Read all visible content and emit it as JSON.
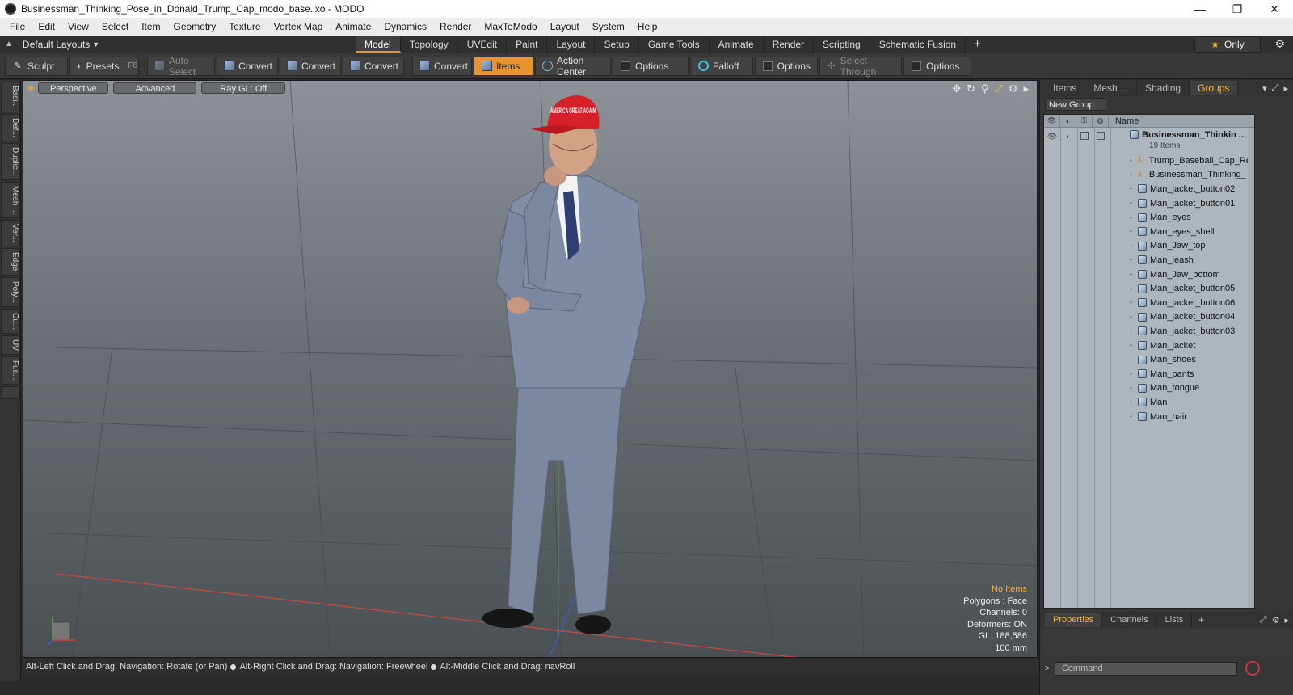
{
  "window": {
    "title": "Businessman_Thinking_Pose_in_Donald_Trump_Cap_modo_base.lxo - MODO",
    "controls": [
      "—",
      "❐",
      "✕"
    ]
  },
  "menubar": [
    "File",
    "Edit",
    "View",
    "Select",
    "Item",
    "Geometry",
    "Texture",
    "Vertex Map",
    "Animate",
    "Dynamics",
    "Render",
    "MaxToModo",
    "Layout",
    "System",
    "Help"
  ],
  "layoutbar": {
    "layouts_label": "Default Layouts",
    "tabs": [
      "Model",
      "Topology",
      "UVEdit",
      "Paint",
      "Layout",
      "Setup",
      "Game Tools",
      "Animate",
      "Render",
      "Scripting",
      "Schematic Fusion"
    ],
    "active_tab": "Model",
    "only_label": "Only"
  },
  "toolbar": {
    "sculpt": "Sculpt",
    "presets": "Presets",
    "presets_shortcut": "F6",
    "auto_select": "Auto Select",
    "convert1": "Convert",
    "convert2": "Convert",
    "convert3": "Convert",
    "convert4": "Convert",
    "items": "Items",
    "action_center": "Action Center",
    "options1": "Options",
    "falloff": "Falloff",
    "options2": "Options",
    "select_through": "Select Through",
    "options3": "Options"
  },
  "leftstrip": [
    "Basi...",
    "Def...",
    "Duplic...",
    "Mesh ...",
    "Ver...",
    "Edge",
    "Poly...",
    "Cu...",
    "UV",
    "Fus..."
  ],
  "viewport": {
    "view_mode": "Perspective",
    "shading": "Advanced",
    "raygl": "Ray GL: Off",
    "stats": {
      "selection": "No Items",
      "polygons": "Polygons : Face",
      "channels": "Channels: 0",
      "deformers": "Deformers: ON",
      "gl": "GL: 188,586",
      "scale": "100 mm"
    },
    "cap_text": "AMERICA GREAT AGAIN"
  },
  "statusbar": {
    "hint1": "Alt-Left Click and Drag: Navigation: Rotate (or Pan)",
    "hint2": "Alt-Right Click and Drag: Navigation: Freewheel",
    "hint3": "Alt-Middle Click and Drag: navRoll"
  },
  "rightpanel": {
    "tabs": [
      "Items",
      "Mesh ...",
      "Shading",
      "Groups"
    ],
    "active_tab": "Groups",
    "new_group": "New Group",
    "name_header": "Name",
    "group_name": "Businessman_Thinkin ...",
    "group_count": "19 Items",
    "items": [
      "Trump_Baseball_Cap_Red",
      "Businessman_Thinking_ ...",
      "Man_jacket_button02",
      "Man_jacket_button01",
      "Man_eyes",
      "Man_eyes_shell",
      "Man_Jaw_top",
      "Man_leash",
      "Man_Jaw_bottom",
      "Man_jacket_button05",
      "Man_jacket_button06",
      "Man_jacket_button04",
      "Man_jacket_button03",
      "Man_jacket",
      "Man_shoes",
      "Man_pants",
      "Man_tongue",
      "Man",
      "Man_hair"
    ],
    "bottom_tabs": [
      "Properties",
      "Channels",
      "Lists"
    ],
    "bottom_active": "Properties",
    "command_placeholder": "Command"
  },
  "colors": {
    "accent": "#e8932e",
    "highlight_text": "#f3b33d",
    "cap_red": "#d8202a",
    "suit": "#7f8ba3"
  }
}
